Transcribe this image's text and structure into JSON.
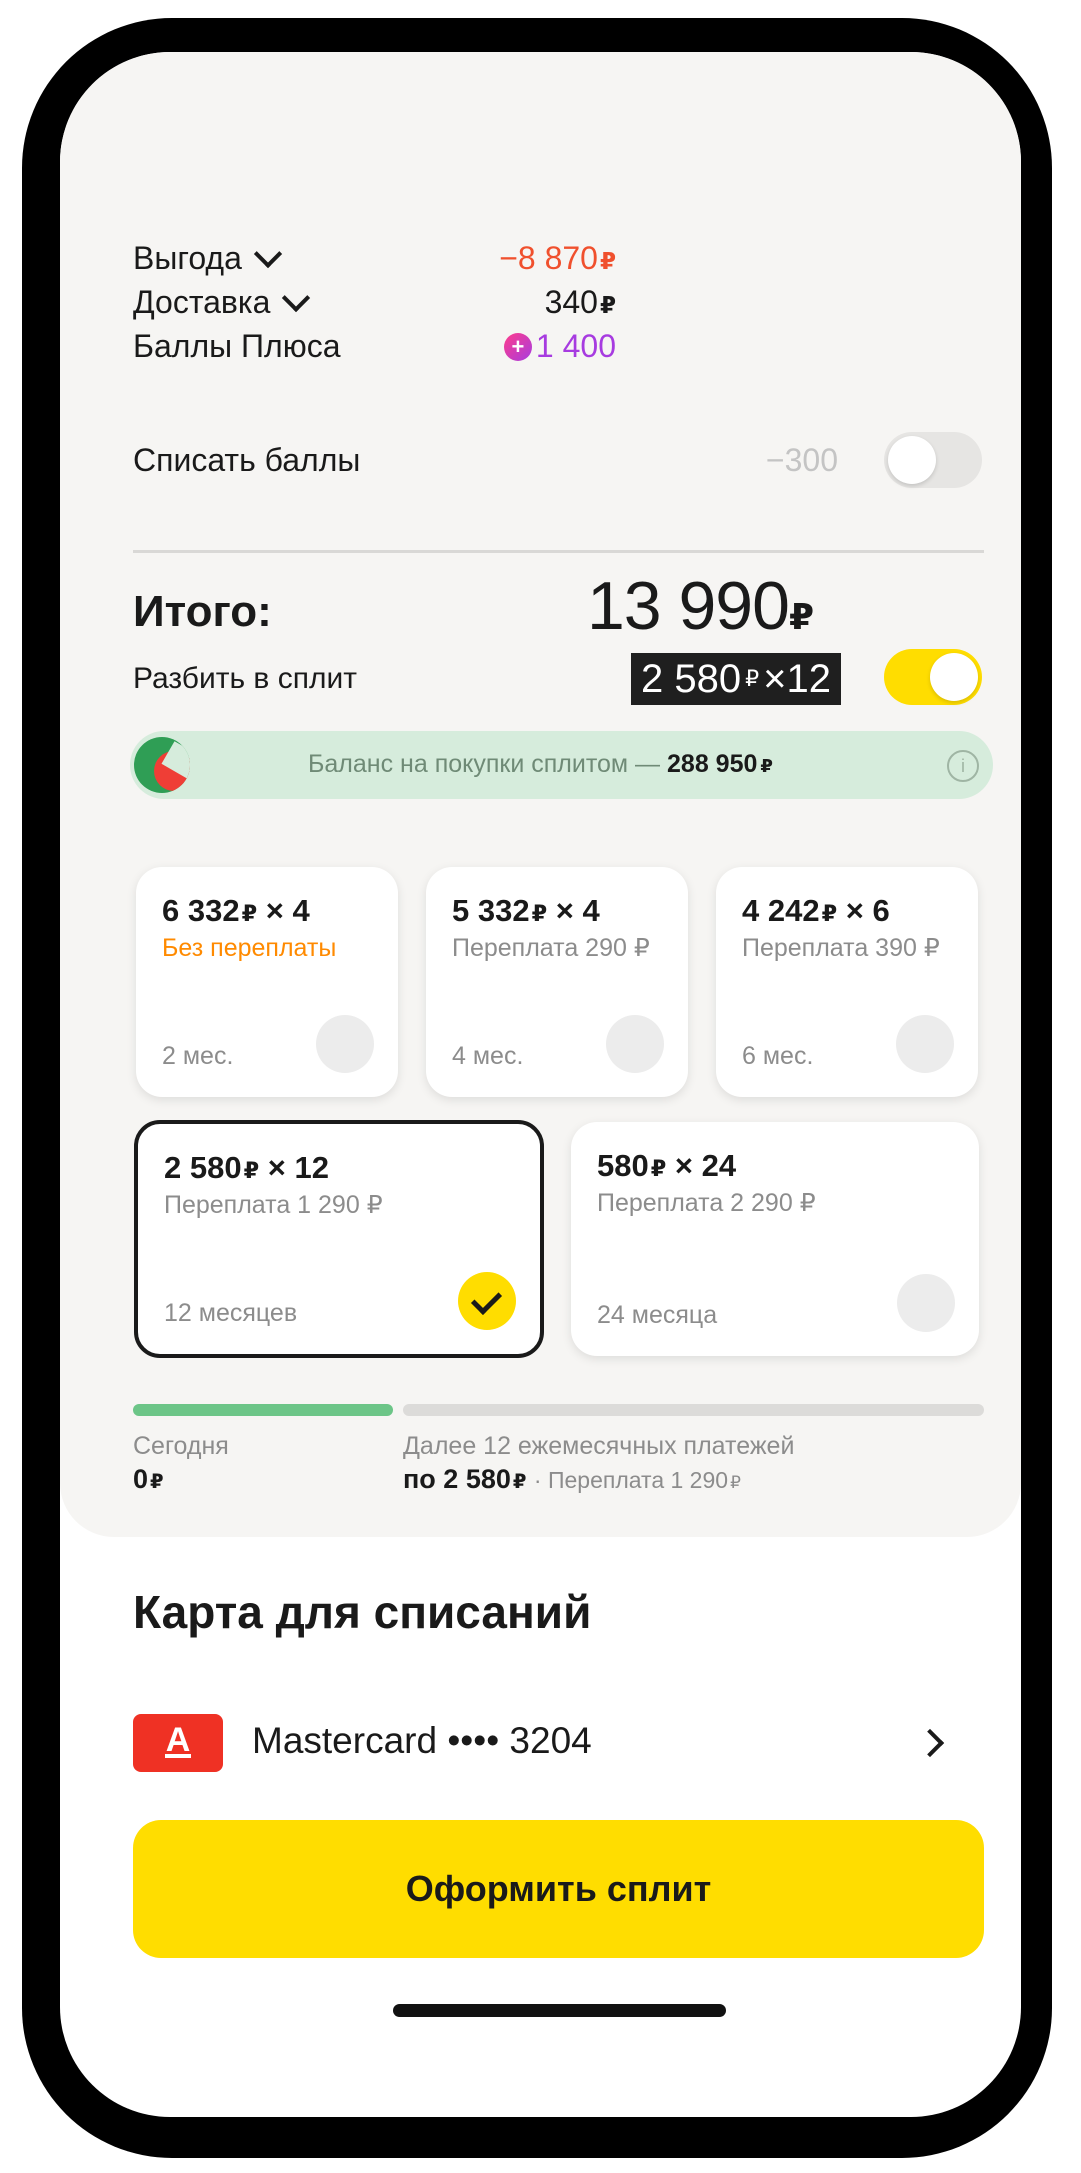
{
  "summary": {
    "benefit_label": "Выгода",
    "benefit_value": "−8 870",
    "delivery_label": "Доставка",
    "delivery_value": "340",
    "plus_label": "Баллы Плюса",
    "plus_value": "1 400",
    "writeoff_label": "Списать баллы",
    "writeoff_value": "−300",
    "writeoff_enabled": false
  },
  "total": {
    "label": "Итого:",
    "amount": "13 990",
    "split_label": "Разбить в сплит",
    "split_chip_amount": "2 580",
    "split_chip_months": "×12",
    "split_enabled": true
  },
  "balance": {
    "text": "Баланс на покупки сплитом —",
    "amount": "288 950"
  },
  "currency": "₽",
  "plans": [
    {
      "amount": "6 332",
      "mult": "× 4",
      "note": "Без переплаты",
      "term": "2 мес.",
      "selected": false
    },
    {
      "amount": "5 332",
      "mult": "× 4",
      "note": "Переплата 290",
      "term": "4 мес.",
      "selected": false
    },
    {
      "amount": "4 242",
      "mult": "× 6",
      "note": "Переплата 390",
      "term": "6 мес.",
      "selected": false
    },
    {
      "amount": "2 580",
      "mult": "× 12",
      "note": "Переплата 1 290",
      "term": "12 месяцев",
      "selected": true
    },
    {
      "amount": "580",
      "mult": "× 24",
      "note": "Переплата 2 290",
      "term": "24 месяца",
      "selected": false
    }
  ],
  "schedule": {
    "today_label": "Сегодня",
    "today_value": "0",
    "later_label": "Далее 12 ежемесячных платежей",
    "later_value": "по 2 580",
    "later_overpay": "· Переплата 1 290",
    "progress_today_fraction": 0.3
  },
  "card_section": {
    "title": "Карта для списаний",
    "bank_logo_letter": "А",
    "card_name": "Mastercard •••• 3204"
  },
  "cta": {
    "label": "Оформить сплит"
  },
  "colors": {
    "accent_yellow": "#ffdd00",
    "benefit_red": "#f0502d",
    "plus_purple": "#a73be0",
    "balance_green": "#d6ecdc",
    "progress_green": "#6cc587",
    "bank_red": "#ef3124",
    "overpay_orange": "#ff8a00"
  }
}
